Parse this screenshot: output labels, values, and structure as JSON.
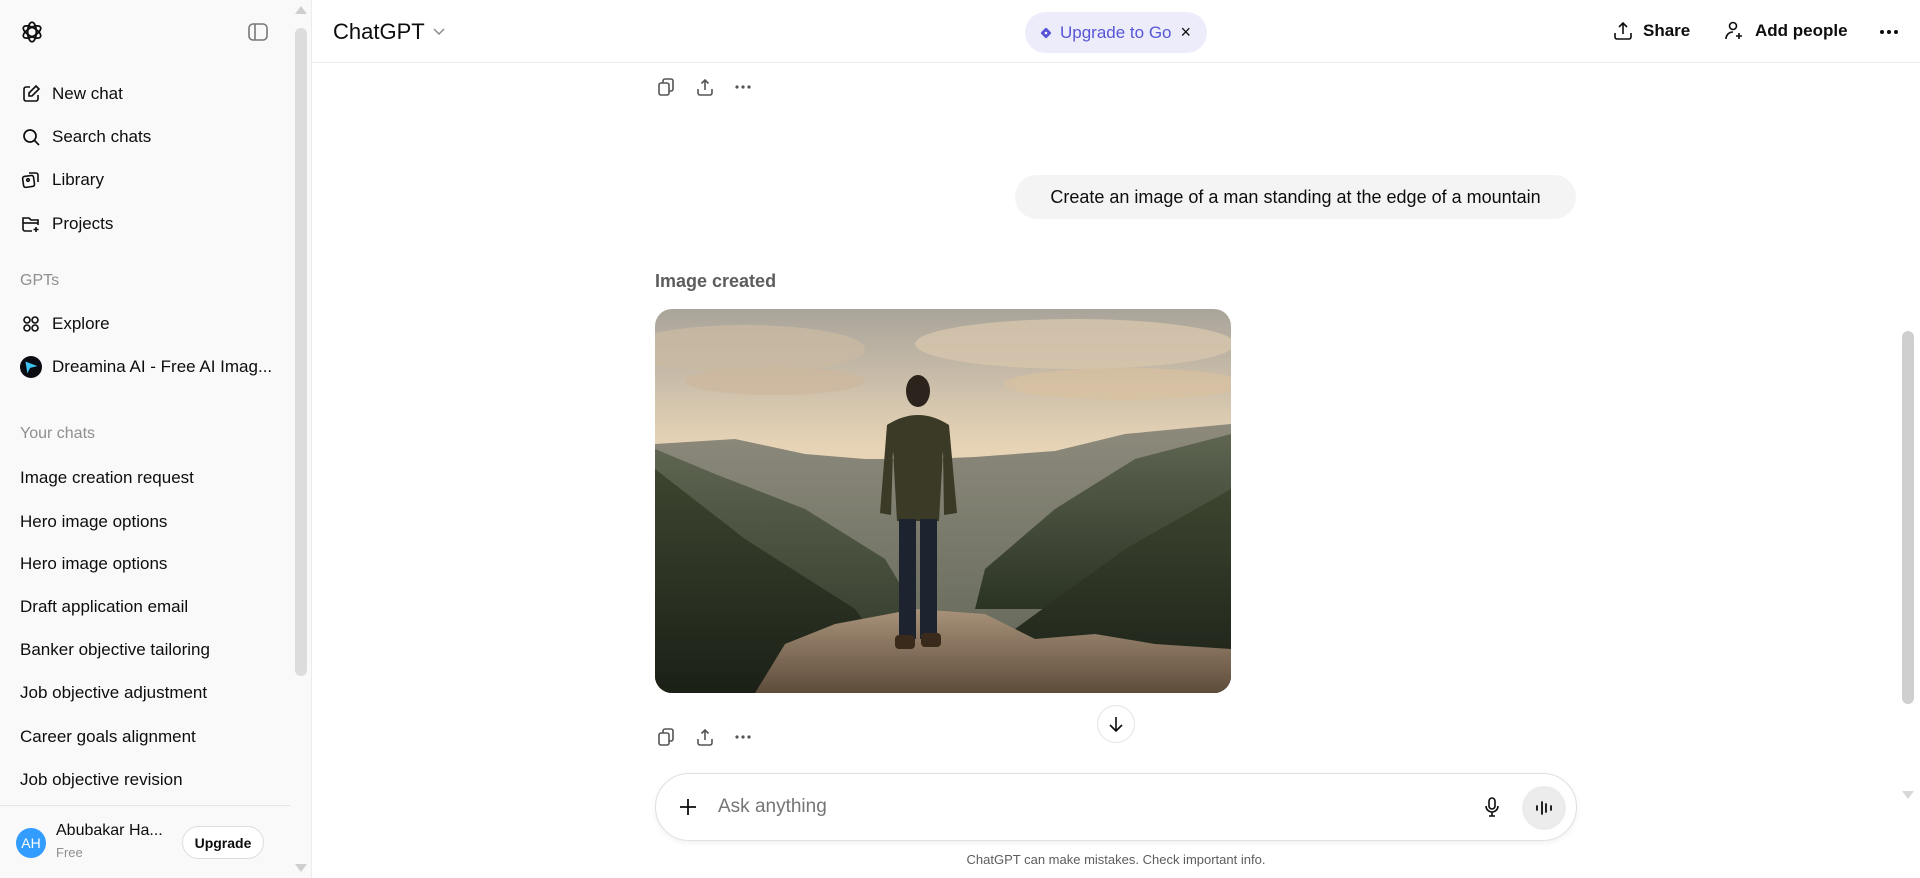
{
  "sidebar": {
    "nav": [
      {
        "label": "New chat",
        "icon": "new-chat-icon"
      },
      {
        "label": "Search chats",
        "icon": "search-icon"
      },
      {
        "label": "Library",
        "icon": "library-icon"
      },
      {
        "label": "Projects",
        "icon": "folder-plus-icon"
      }
    ],
    "gpts_heading": "GPTs",
    "gpts": [
      {
        "label": "Explore",
        "icon": "grid-icon"
      },
      {
        "label": "Dreamina AI - Free AI Imag...",
        "icon": "dreamina-logo-icon"
      }
    ],
    "chats_heading": "Your chats",
    "chats": [
      "Image creation request",
      "Hero image options",
      "Hero image options",
      "Draft application email",
      "Banker objective tailoring",
      "Job objective adjustment",
      "Career goals alignment",
      "Job objective revision"
    ],
    "profile": {
      "initials": "AH",
      "name": "Abubakar Ha...",
      "plan": "Free",
      "upgrade_label": "Upgrade",
      "avatar_color": "#339cff"
    }
  },
  "header": {
    "model": "ChatGPT",
    "upgrade_pill": "Upgrade to Go",
    "upgrade_close": "×",
    "share": "Share",
    "add_people": "Add people",
    "accent": "#5856d6"
  },
  "conversation": {
    "user_message": "Create an image of a man standing at the edge of a mountain",
    "image_status": "Image created"
  },
  "composer": {
    "placeholder": "Ask anything",
    "disclaimer": "ChatGPT can make mistakes. Check important info."
  }
}
